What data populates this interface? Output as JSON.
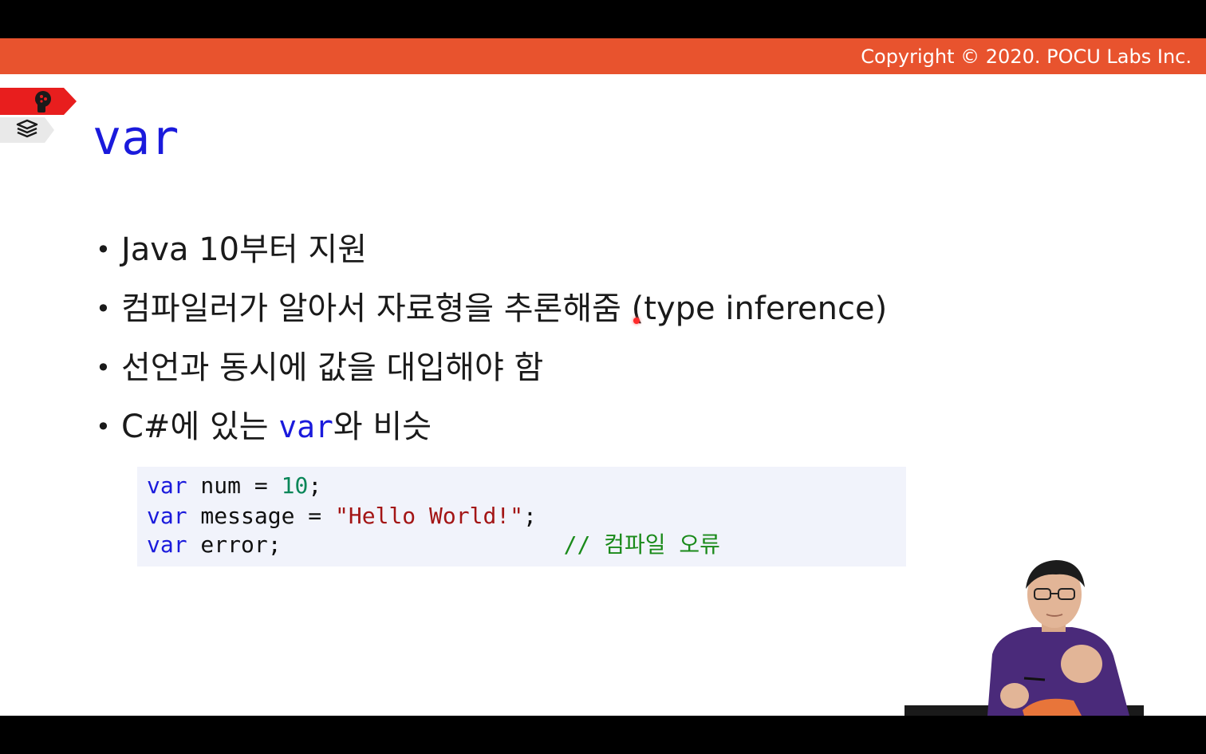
{
  "header": {
    "copyright": "Copyright © 2020. POCU Labs Inc."
  },
  "slide": {
    "title": "var",
    "bullets": [
      {
        "text": "Java 10부터 지원"
      },
      {
        "text": "컴파일러가 알아서 자료형을 추론해줌 (type inference)"
      },
      {
        "text": "선언과 동시에 값을 대입해야 함"
      },
      {
        "prefix": "C#에 있는 ",
        "keyword": "var",
        "suffix": "와 비슷"
      }
    ],
    "code": {
      "line1": {
        "kw": "var",
        "rest": " num = ",
        "num": "10",
        "end": ";"
      },
      "line2": {
        "kw": "var",
        "rest": " message = ",
        "str": "\"Hello World!\"",
        "end": ";"
      },
      "line3": {
        "kw": "var",
        "rest": " error;",
        "pad": "                     ",
        "comment": "// 컴파일 오류"
      }
    }
  },
  "icons": {
    "red_tab": "brain-head-icon",
    "gray_tab": "book-stack-icon"
  },
  "colors": {
    "topbar": "#e8532e",
    "keyword": "#1a1adc",
    "number": "#098658",
    "string": "#a31515",
    "comment": "#1a8a1a",
    "code_bg": "#f1f3fb"
  }
}
